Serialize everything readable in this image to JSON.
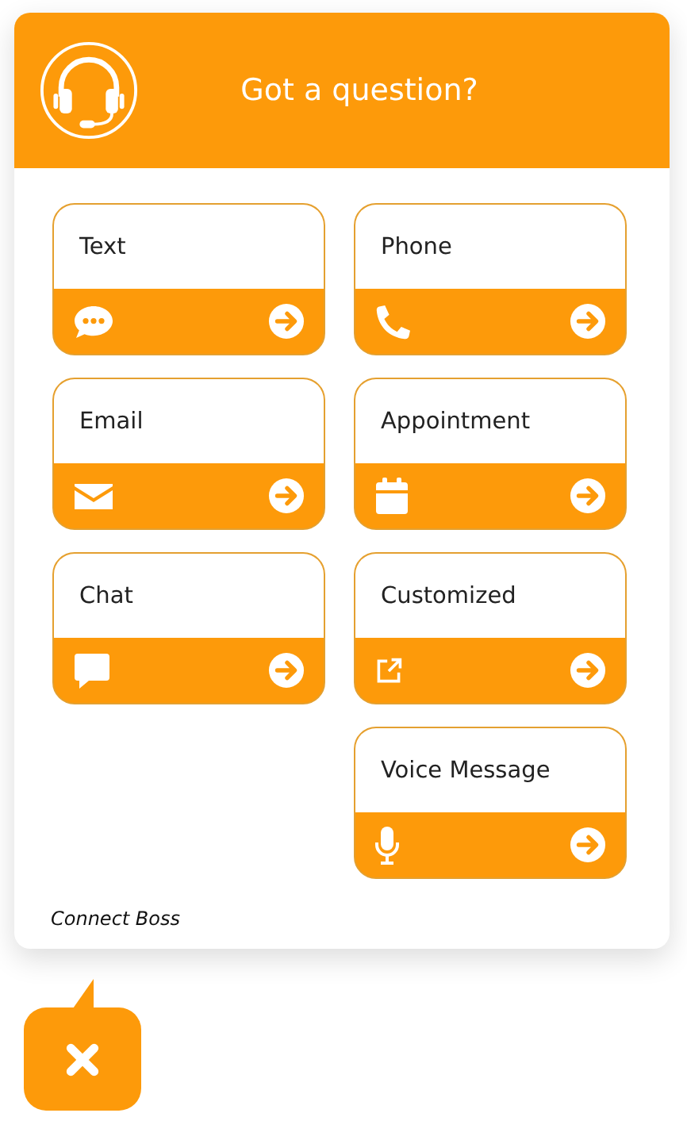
{
  "header": {
    "title": "Got a question?"
  },
  "options": [
    {
      "kind": "text",
      "label": "Text"
    },
    {
      "kind": "phone",
      "label": "Phone"
    },
    {
      "kind": "email",
      "label": "Email"
    },
    {
      "kind": "appointment",
      "label": "Appointment"
    },
    {
      "kind": "chat",
      "label": "Chat"
    },
    {
      "kind": "customized",
      "label": "Customized"
    },
    {
      "kind": "voice",
      "label": "Voice Message"
    }
  ],
  "footer": {
    "brand": "Connect Boss"
  }
}
